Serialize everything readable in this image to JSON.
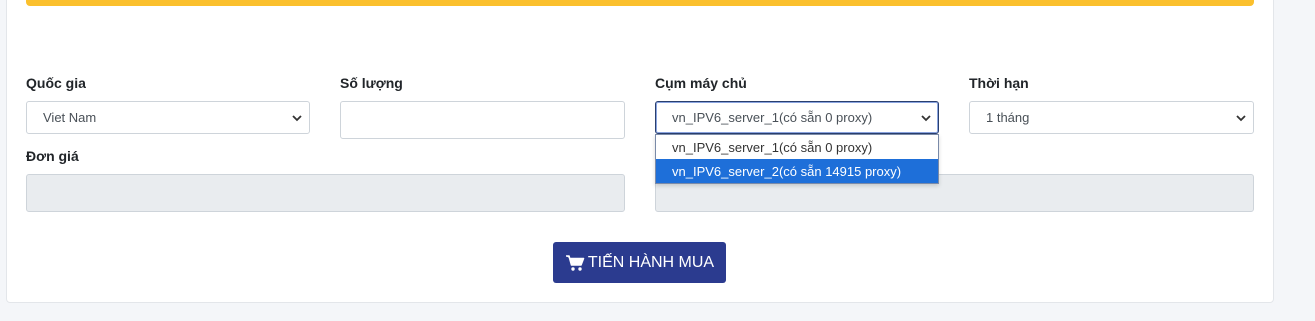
{
  "form": {
    "country": {
      "label": "Quốc gia",
      "value": "Viet Nam"
    },
    "quantity": {
      "label": "Số lượng",
      "value": ""
    },
    "server_cluster": {
      "label": "Cụm máy chủ",
      "value": "vn_IPV6_server_1(có sẵn 0 proxy)",
      "options": [
        "vn_IPV6_server_1(có sẵn 0 proxy)",
        "vn_IPV6_server_2(có sẵn 14915 proxy)"
      ],
      "highlighted_index": 1
    },
    "duration": {
      "label": "Thời hạn",
      "value": "1 tháng"
    },
    "unit_price": {
      "label": "Đơn giá",
      "value": ""
    },
    "total": {
      "value": ""
    }
  },
  "buy_button": {
    "label": "TIẾN HÀNH MUA",
    "icon": "cart-icon"
  },
  "colors": {
    "warning": "#fbc02d",
    "primary_button": "#2b3b8f",
    "option_highlight": "#1e6fd9"
  }
}
